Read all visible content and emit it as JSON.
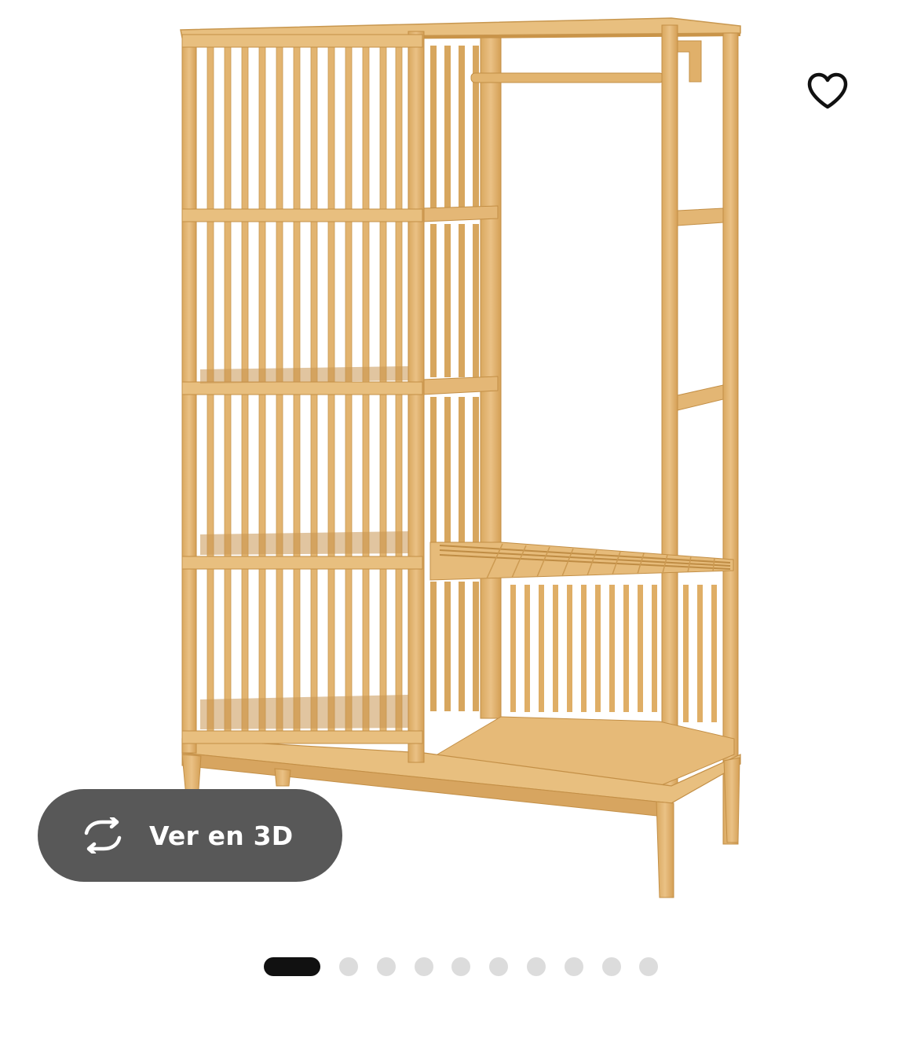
{
  "image": {
    "alt": "",
    "colors": {
      "wood": "#e0b26c",
      "wood_light": "#ecc78a",
      "wood_dark": "#c38f46",
      "wood_shadow": "#b07e3a"
    }
  },
  "favorite": {
    "icon": "heart-outline-icon"
  },
  "view3d": {
    "label": "Ver en 3D",
    "icon": "rotate-3d-icon",
    "bg": "#585858"
  },
  "carousel": {
    "total": 10,
    "current": 1,
    "active_color": "#111111",
    "inactive_color": "#dcdcdc"
  }
}
